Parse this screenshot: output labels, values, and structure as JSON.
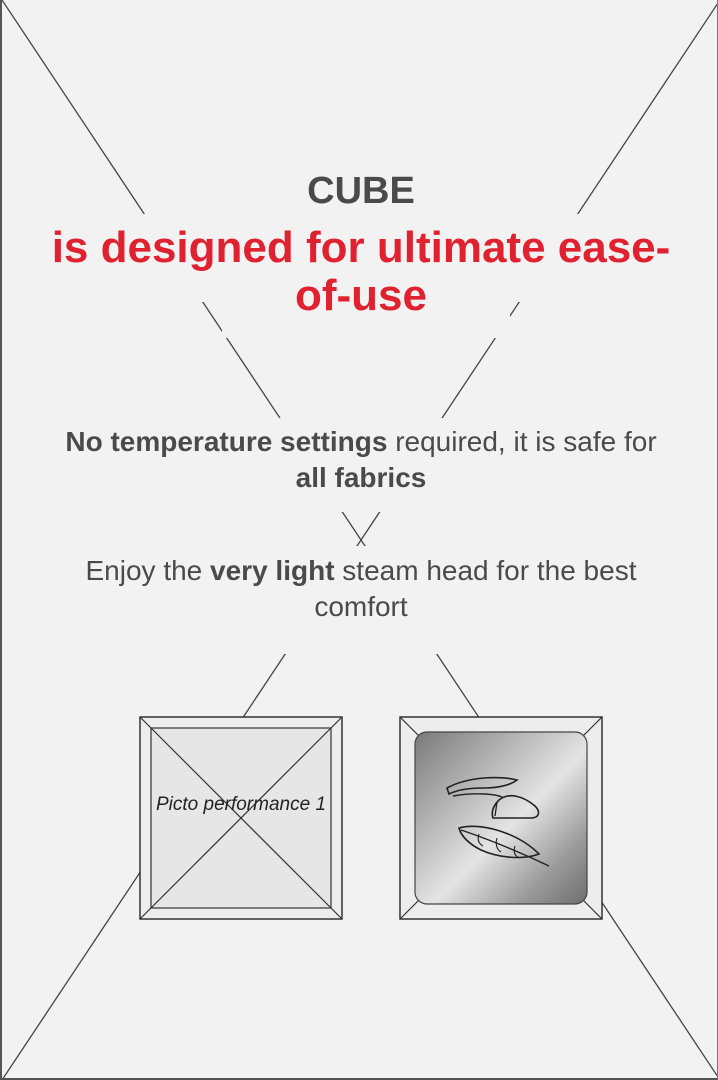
{
  "title": "CUBE",
  "headline": "is designed for ultimate ease-of-use",
  "para1": {
    "lead_bold": "No temperature settings",
    "middle": " required, it is safe for ",
    "tail_bold": "all fabrics"
  },
  "para2": {
    "lead": "Enjoy the ",
    "bold": "very light",
    "tail": " steam head for the best comfort"
  },
  "picto1": {
    "label": "Picto performance 1",
    "icon": "placeholder-cross-icon"
  },
  "picto2": {
    "icon": "iron-feather-icon"
  },
  "colors": {
    "accent": "#e0212f",
    "text": "#4a4a4a",
    "background": "#f2f2f2"
  }
}
